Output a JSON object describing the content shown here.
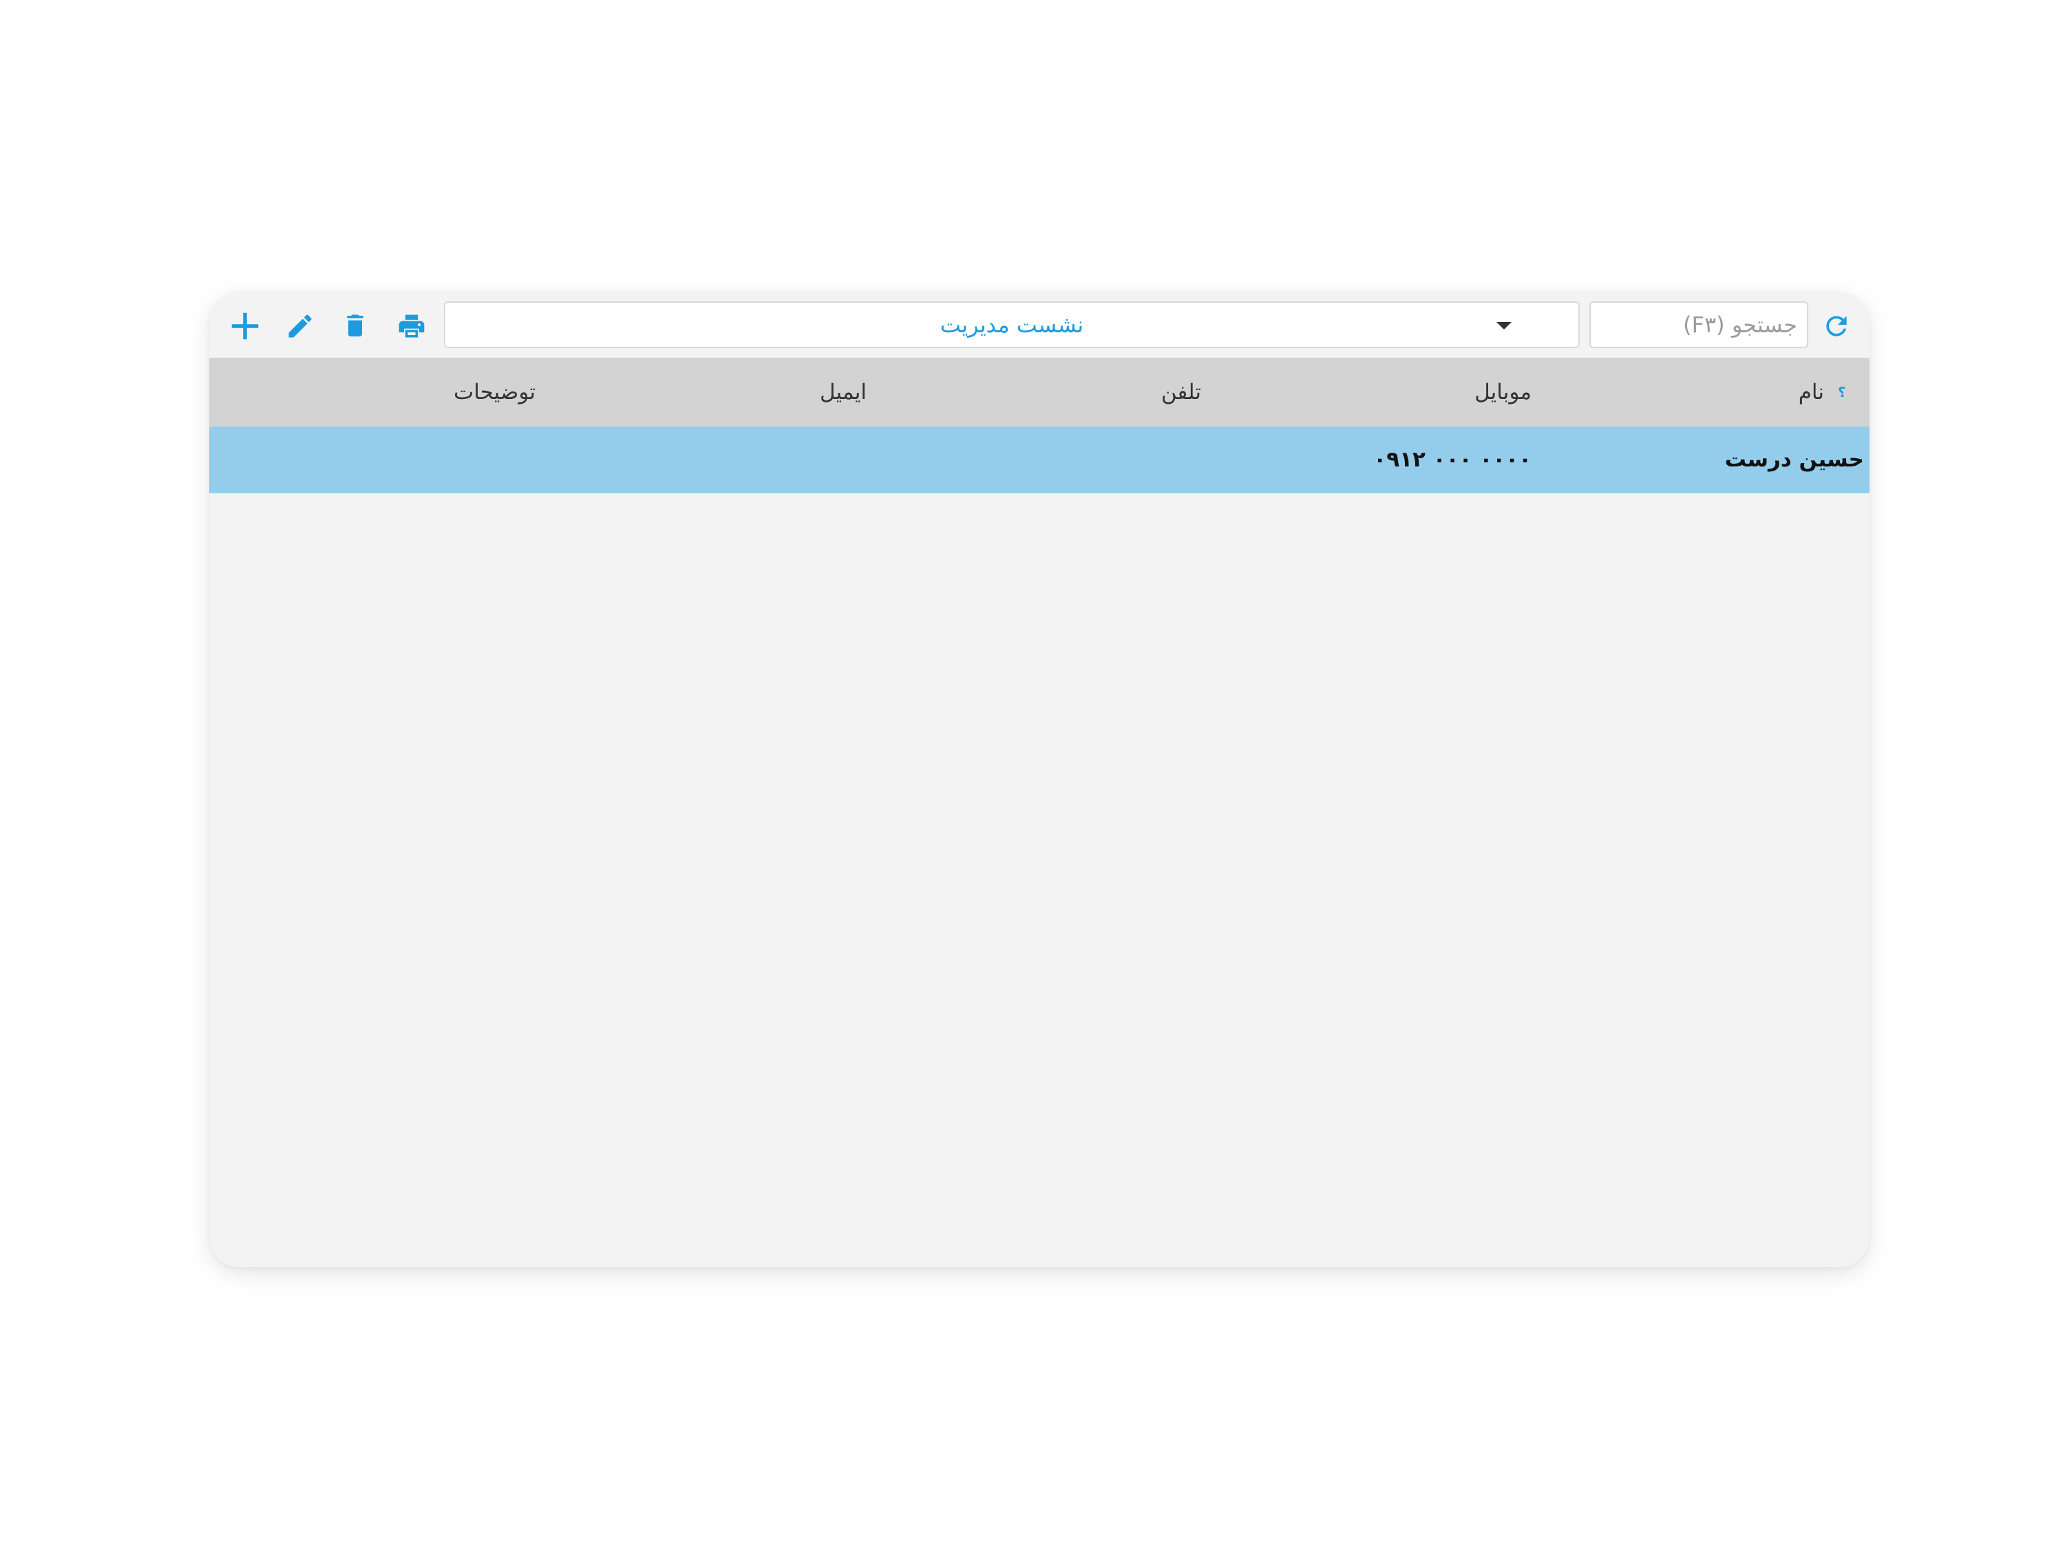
{
  "toolbar": {
    "icons": [
      "refresh-icon",
      "print-icon",
      "trash-icon",
      "pencil-icon",
      "plus-icon"
    ],
    "session_select": {
      "value": "نشست مدیریت"
    },
    "search": {
      "placeholder": "جستجو (F۳)",
      "value": ""
    }
  },
  "table": {
    "sort_marker": "؟",
    "columns": [
      "نام",
      "موبایل",
      "تلفن",
      "ایمیل",
      "توضیحات"
    ],
    "rows": [
      {
        "name": "حسین درست",
        "mobile": "۰۹۱۲ ۰۰۰ ۰۰۰۰",
        "phone": "",
        "email": "",
        "notes": ""
      }
    ]
  },
  "colors": {
    "accent": "#1e9be0",
    "header_bg": "#d3d3d3",
    "selected_row": "#94cdeb",
    "panel_bg": "#f3f3f3"
  }
}
